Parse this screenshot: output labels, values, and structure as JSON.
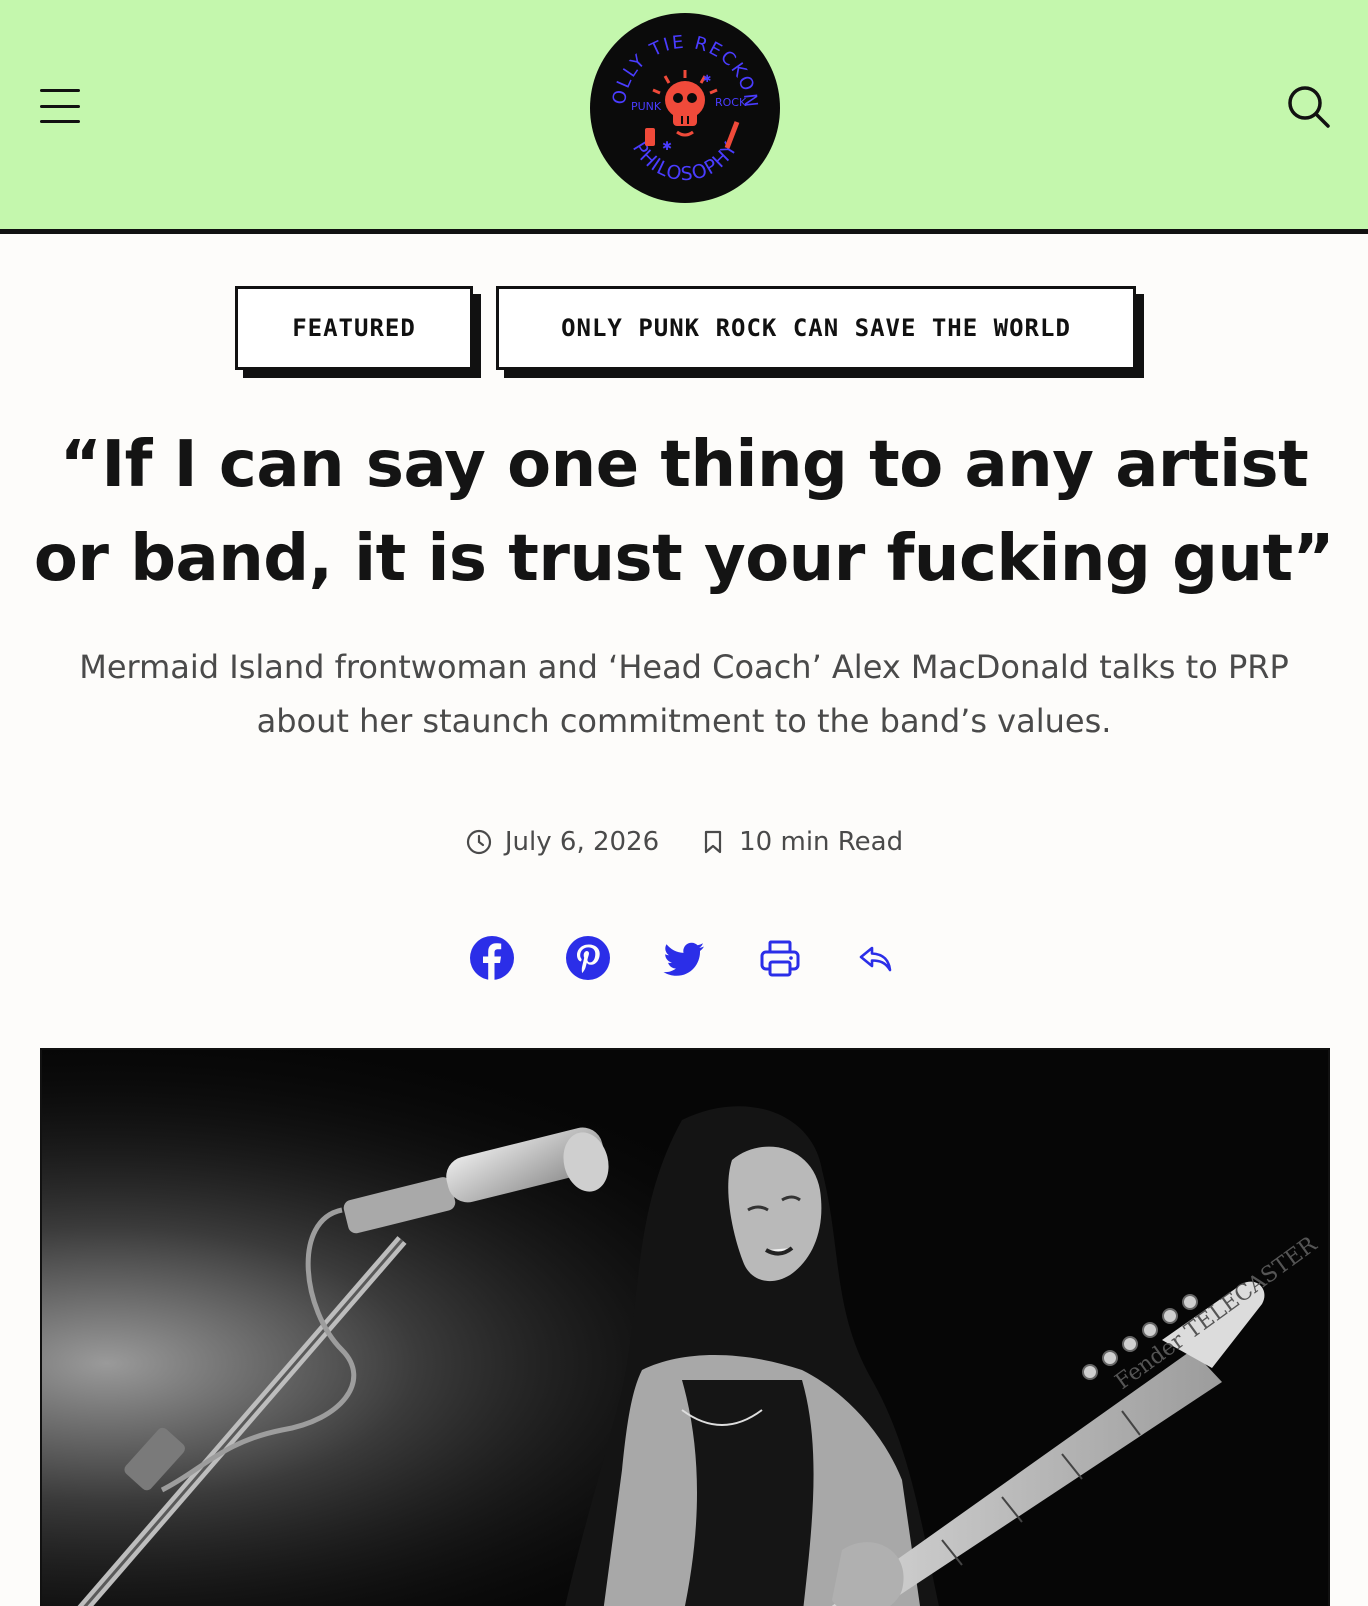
{
  "header": {
    "logo_text": {
      "top": "MOLLY TIE RECKONS",
      "left": "PUNK",
      "right": "ROCK",
      "bottom": "PHILOSOPHY"
    },
    "background_color": "#c4f7ad"
  },
  "article": {
    "tags": [
      "FEATURED",
      "ONLY PUNK ROCK CAN SAVE THE WORLD"
    ],
    "title": "“If I can say one thing to any artist or band, it is trust your fucking gut”",
    "subtitle": "Mermaid Island frontwoman and ‘Head Coach’ Alex MacDonald talks to PRP about her staunch commitment to the band’s values.",
    "date": "July 6, 2026",
    "read_time": "10 min Read",
    "share_icons": [
      "facebook-icon",
      "pinterest-icon",
      "twitter-icon",
      "print-icon",
      "share-icon"
    ],
    "accent_color": "#2b2ee8",
    "hero_image": {
      "guitar_headstock_text": "Fender TELECASTER"
    }
  }
}
